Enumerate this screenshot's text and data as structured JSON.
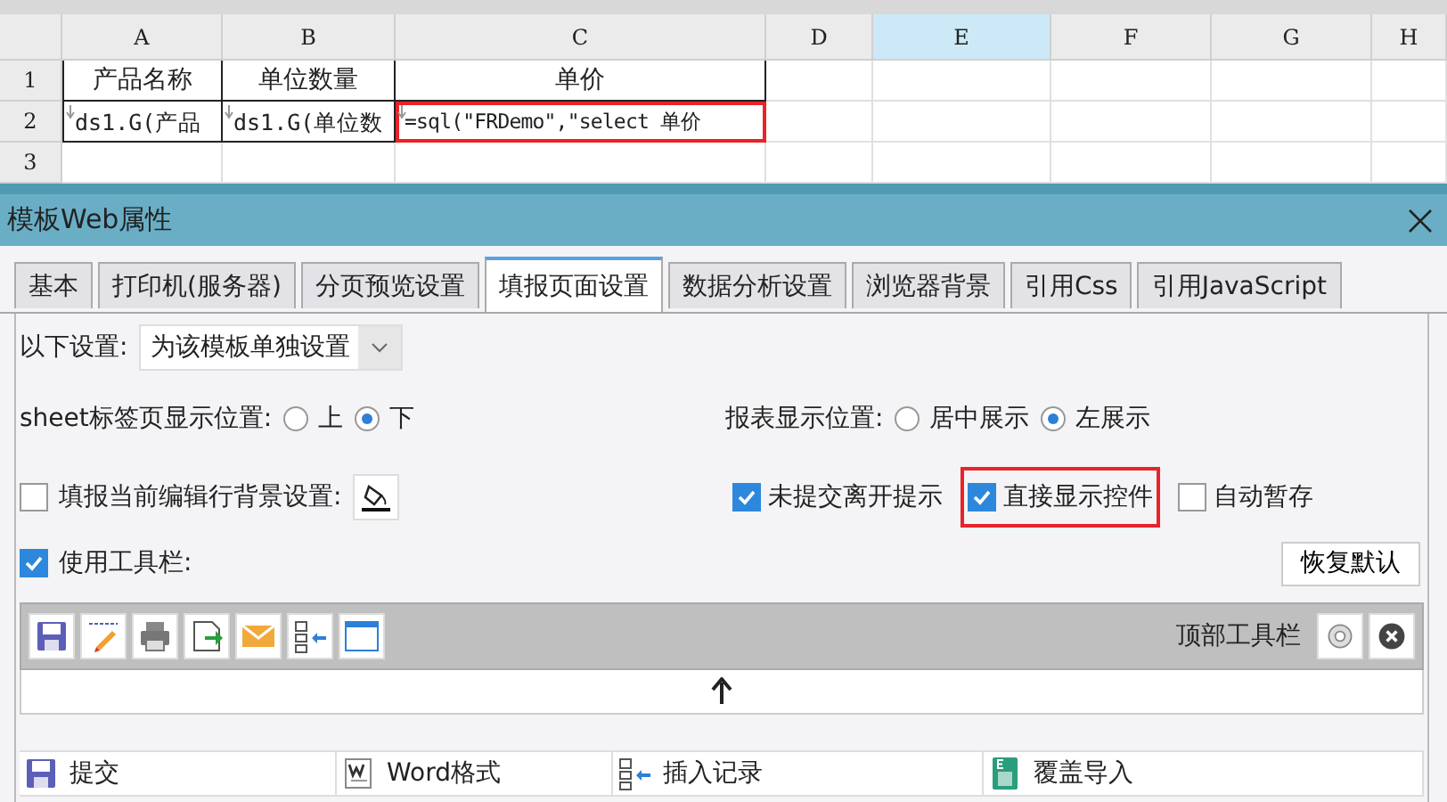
{
  "spreadsheet": {
    "columns": [
      {
        "label": "A",
        "selected": false
      },
      {
        "label": "B",
        "selected": false
      },
      {
        "label": "C",
        "selected": false
      },
      {
        "label": "D",
        "selected": false
      },
      {
        "label": "E",
        "selected": true
      },
      {
        "label": "F",
        "selected": false
      },
      {
        "label": "G",
        "selected": false
      },
      {
        "label": "H",
        "selected": false
      }
    ],
    "rows": [
      {
        "label": "1",
        "cells": [
          {
            "text": "产品名称",
            "highlighted": false
          },
          {
            "text": "单位数量",
            "highlighted": false
          },
          {
            "text": "单价",
            "highlighted": false
          }
        ]
      },
      {
        "label": "2",
        "cells": [
          {
            "text": "ds1.G(产品",
            "highlighted": false
          },
          {
            "text": "ds1.G(单位数",
            "highlighted": false
          },
          {
            "text": "=sql(\"FRDemo\",\"select 单价",
            "highlighted": true
          }
        ]
      },
      {
        "label": "3"
      }
    ]
  },
  "dialog": {
    "title": "模板Web属性",
    "tabs": [
      {
        "label": "基本",
        "selected": false
      },
      {
        "label": "打印机(服务器)",
        "selected": false
      },
      {
        "label": "分页预览设置",
        "selected": false
      },
      {
        "label": "填报页面设置",
        "selected": true
      },
      {
        "label": "数据分析设置",
        "selected": false
      },
      {
        "label": "浏览器背景",
        "selected": false
      },
      {
        "label": "引用Css",
        "selected": false
      },
      {
        "label": "引用JavaScript",
        "selected": false
      }
    ],
    "settings_scope": {
      "label": "以下设置:",
      "value": "为该模板单独设置"
    },
    "sheet_tab_position": {
      "label": "sheet标签页显示位置:",
      "options": [
        {
          "label": "上",
          "selected": false
        },
        {
          "label": "下",
          "selected": true
        }
      ]
    },
    "report_position": {
      "label": "报表显示位置:",
      "options": [
        {
          "label": "居中展示",
          "selected": false
        },
        {
          "label": "左展示",
          "selected": true
        }
      ]
    },
    "row_background": {
      "label": "填报当前编辑行背景设置:",
      "checked": false
    },
    "options": [
      {
        "label": "未提交离开提示",
        "checked": true,
        "highlighted": false
      },
      {
        "label": "直接显示控件",
        "checked": true,
        "highlighted": true
      },
      {
        "label": "自动暂存",
        "checked": false,
        "highlighted": false
      }
    ],
    "use_toolbar": {
      "label": "使用工具栏:",
      "checked": true
    },
    "reset_button": "恢复默认",
    "toolbar_buttons": [
      {
        "kind": "save"
      },
      {
        "kind": "check"
      },
      {
        "kind": "print"
      },
      {
        "kind": "export"
      },
      {
        "kind": "mail"
      },
      {
        "kind": "insert"
      },
      {
        "kind": "window"
      }
    ],
    "toolbar_position": "顶部工具栏",
    "available_items": [
      {
        "kind": "save",
        "label": "提交"
      },
      {
        "kind": "word",
        "label": "Word格式"
      },
      {
        "kind": "insert",
        "label": "插入记录"
      },
      {
        "kind": "excel",
        "label": "覆盖导入"
      }
    ]
  }
}
